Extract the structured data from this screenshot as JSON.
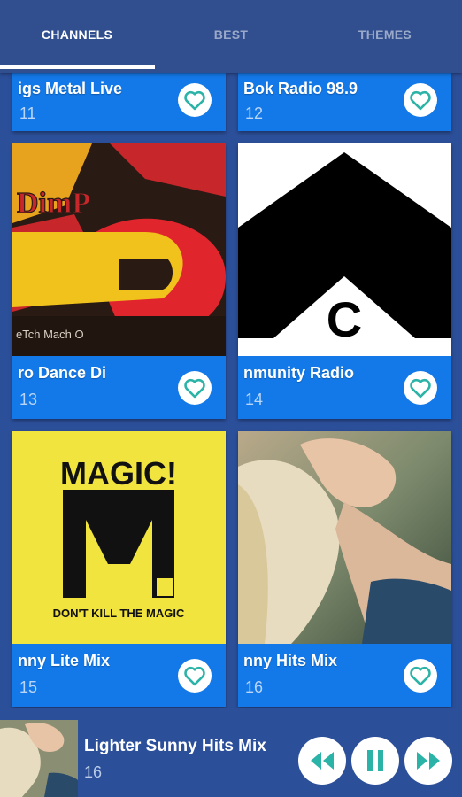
{
  "tabs": [
    {
      "label": "CHANNELS"
    },
    {
      "label": "BEST"
    },
    {
      "label": "THEMES"
    }
  ],
  "cards": [
    {
      "title": "igs Metal Live",
      "number": "11"
    },
    {
      "title": "Bok Radio 98.9",
      "number": "12"
    },
    {
      "title": "ro Dance        Di",
      "number": "13"
    },
    {
      "title": "nmunity Radio",
      "number": "14"
    },
    {
      "title": "nny Lite Mix",
      "number": "15",
      "logo_top": "MAGIC!",
      "logo_letter": "M",
      "logo_tagline": "DON'T KILL THE MAGIC"
    },
    {
      "title": "nny Hits Mix",
      "number": "16"
    }
  ],
  "card_2_logo": {
    "text": "DimP",
    "subtext": "eTch  Mach  O"
  },
  "card_3_logo": {
    "letter": "C"
  },
  "player": {
    "title": "Lighter Sunny Hits Mix",
    "number": "16"
  },
  "colors": {
    "background": "#2c4f9a",
    "tabbar": "#314f8e",
    "card": "#1378e8",
    "icon_accent": "#2bb3a7"
  },
  "icons": {
    "favorite": "heart-outline-icon",
    "rewind": "rewind-icon",
    "pause": "pause-icon",
    "fast_forward": "fast-forward-icon"
  }
}
